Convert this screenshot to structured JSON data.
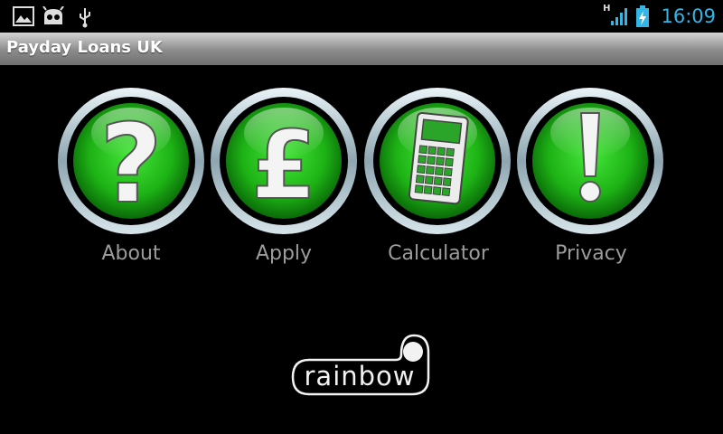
{
  "status_bar": {
    "time": "16:09",
    "network_type": "H",
    "icons": [
      "gallery-icon",
      "android-icon",
      "usb-icon",
      "signal-icon",
      "battery-icon"
    ],
    "accent_color": "#33b5e5"
  },
  "app": {
    "title": "Payday Loans UK"
  },
  "menu": [
    {
      "label": "About",
      "icon": "question-mark-icon"
    },
    {
      "label": "Apply",
      "icon": "pound-sign-icon"
    },
    {
      "label": "Calculator",
      "icon": "calculator-icon"
    },
    {
      "label": "Privacy",
      "icon": "exclamation-mark-icon"
    }
  ],
  "brand": {
    "logo_text": "rainbow"
  },
  "colors": {
    "button_green": "#22c41a",
    "label_gray": "#9c9c9c"
  }
}
